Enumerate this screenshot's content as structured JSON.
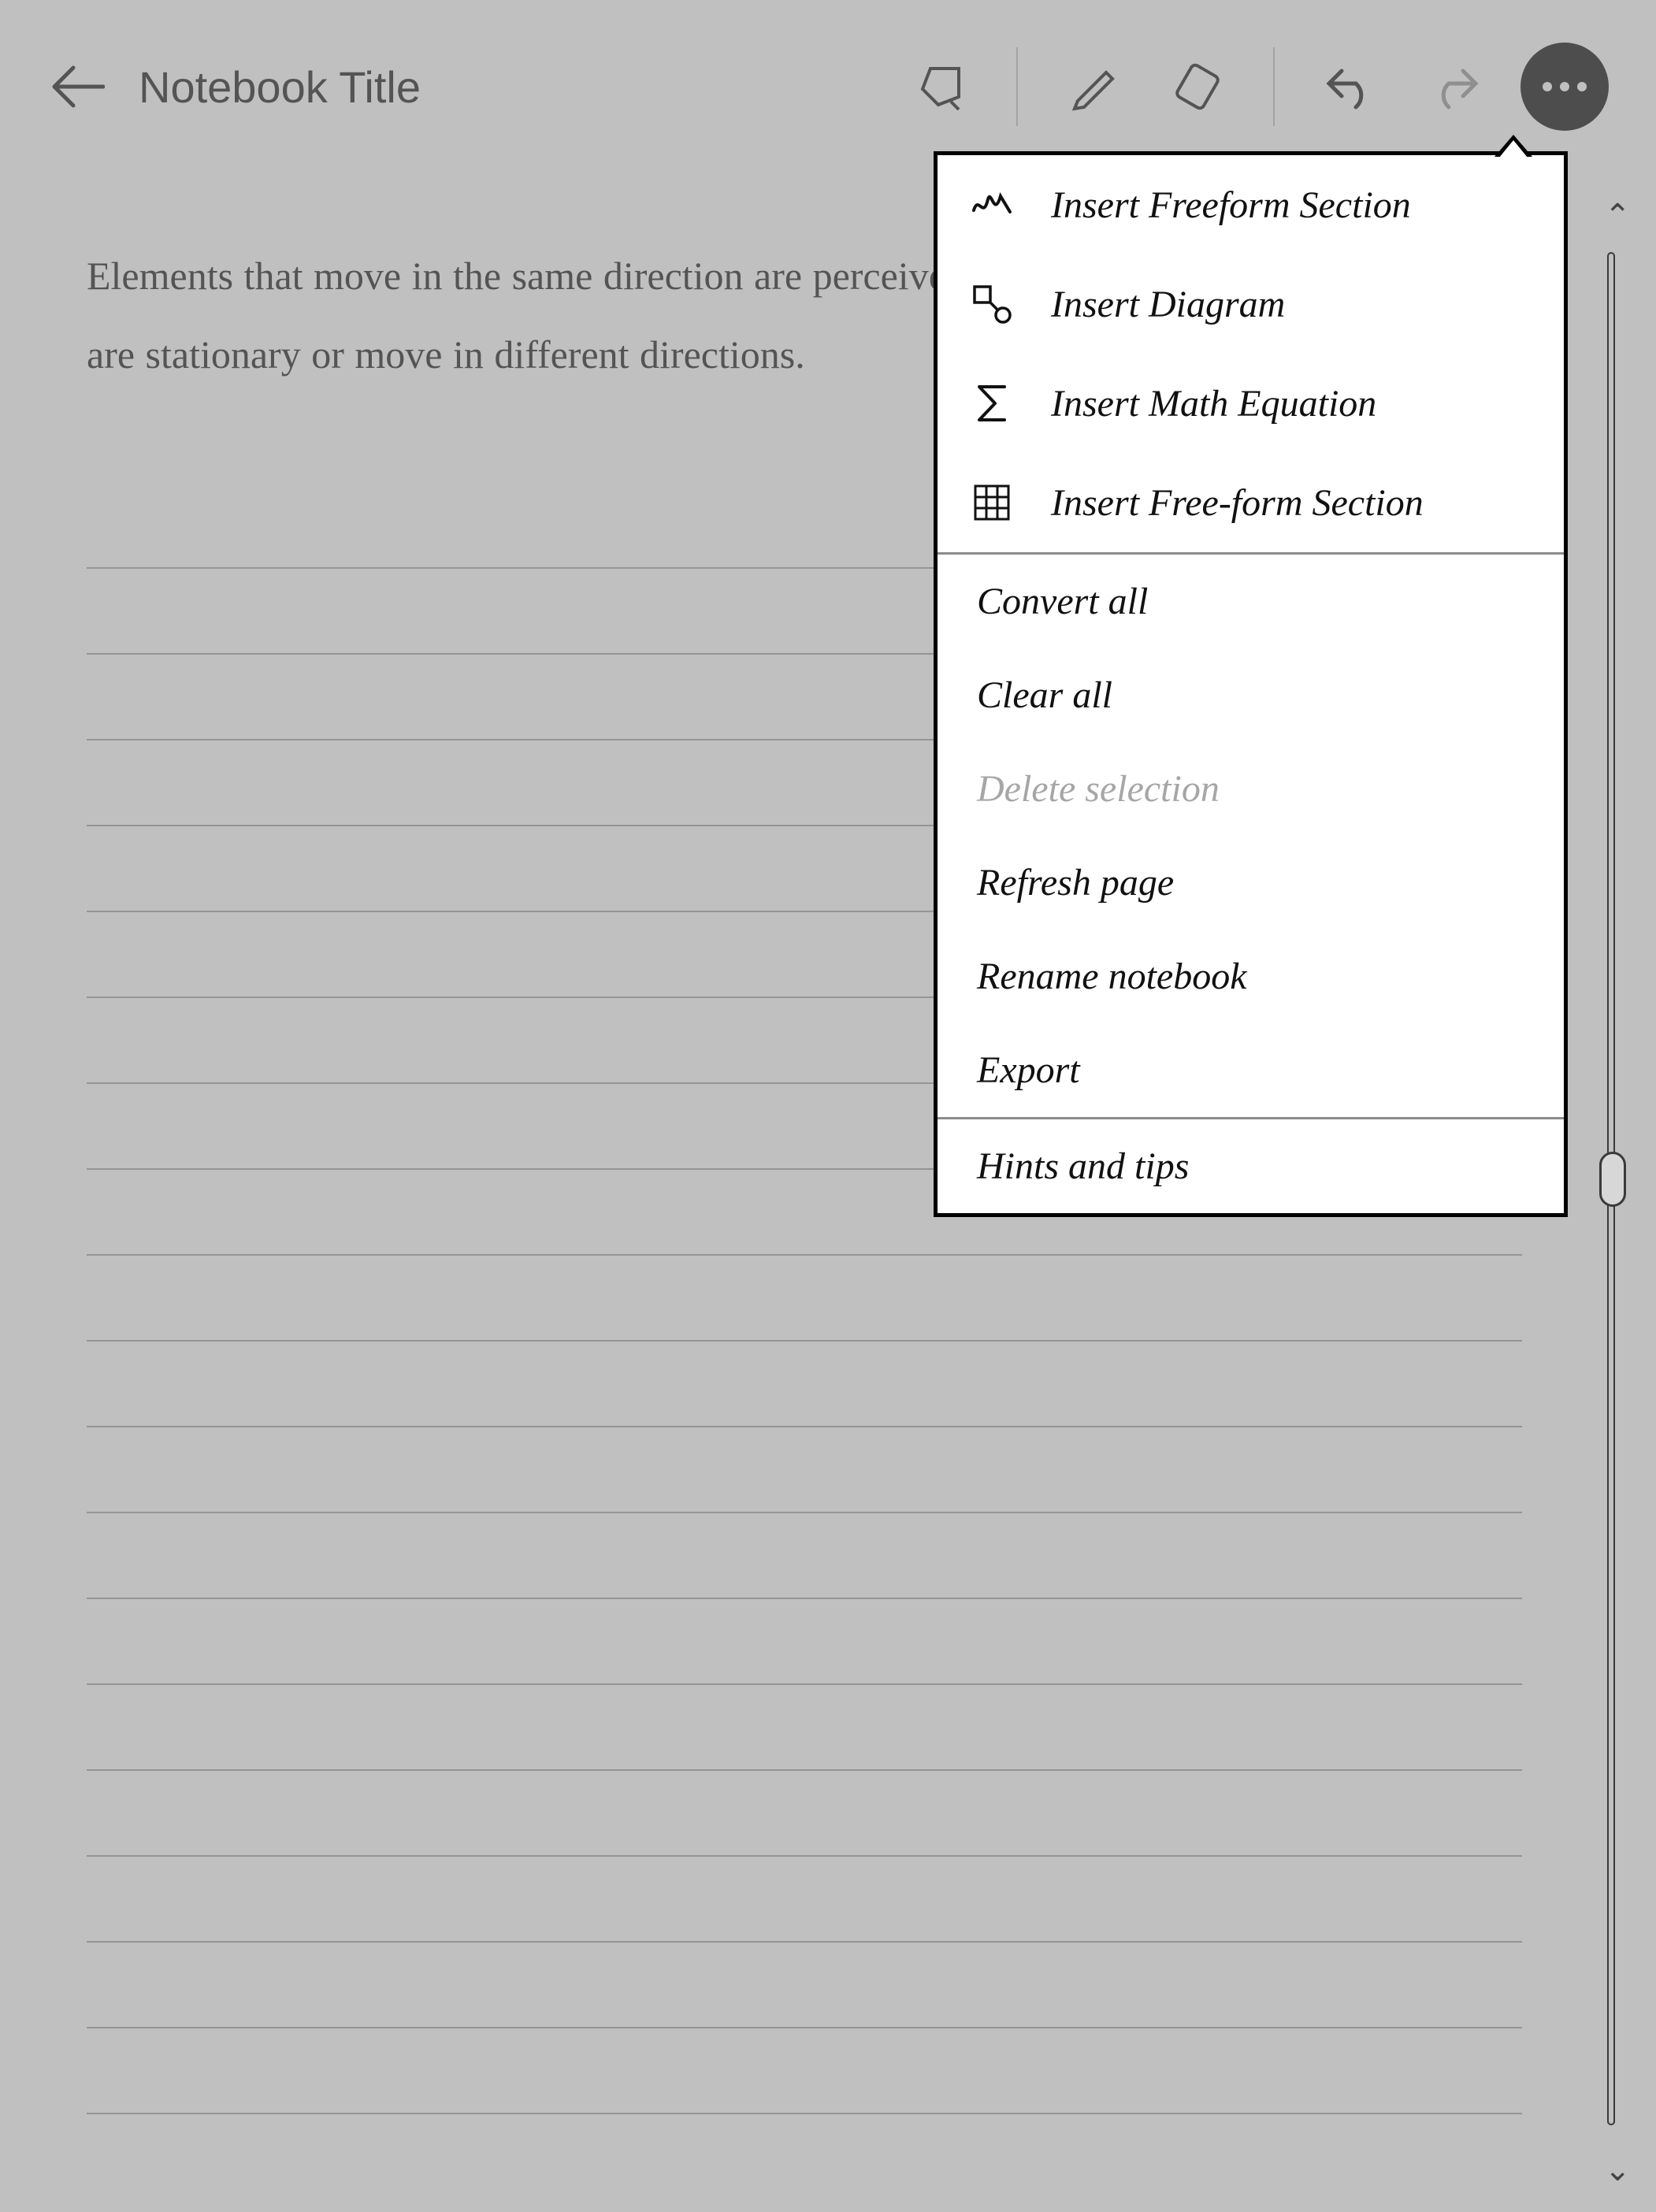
{
  "header": {
    "title": "Notebook Title"
  },
  "body": {
    "text": "Elements that move in the same direction are perceived as more related than elements that are stationary or move in different directions."
  },
  "menu": {
    "section1": [
      {
        "label": "Insert Freeform Section",
        "icon": "scribble"
      },
      {
        "label": "Insert Diagram",
        "icon": "diagram"
      },
      {
        "label": "Insert Math Equation",
        "icon": "sigma"
      },
      {
        "label": "Insert Free-form Section",
        "icon": "grid"
      }
    ],
    "section2": [
      {
        "label": "Convert all",
        "highlight": true
      },
      {
        "label": "Clear all"
      },
      {
        "label": "Delete selection",
        "disabled": true
      },
      {
        "label": "Refresh page"
      },
      {
        "label": "Rename notebook"
      },
      {
        "label": "Export"
      }
    ],
    "section3": [
      {
        "label": "Hints and tips"
      }
    ]
  }
}
